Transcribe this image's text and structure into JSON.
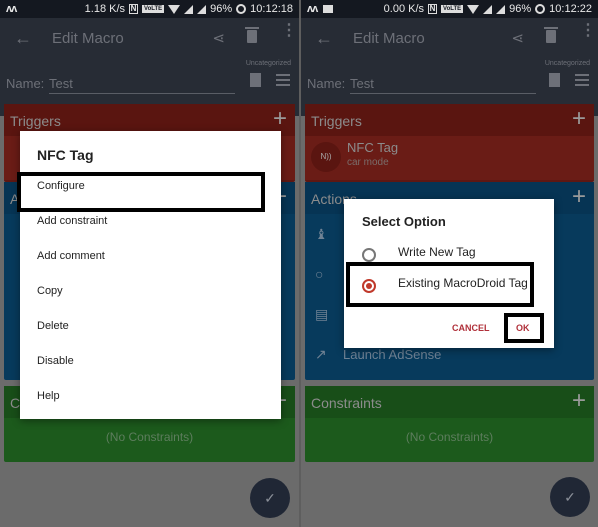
{
  "screens": [
    {
      "status": {
        "speed": "1.18 K/s",
        "battery": "96%",
        "time": "10:12:18"
      },
      "appbar": {
        "title": "Edit Macro",
        "category": "Uncategorized",
        "name_label": "Name:",
        "name_value": "Test"
      },
      "triggers": {
        "label": "Triggers"
      },
      "actions": {
        "label": "Actions"
      },
      "constraints": {
        "label": "Constraints",
        "empty": "(No Constraints)"
      },
      "menu": {
        "title": "NFC Tag",
        "items": [
          "Configure",
          "Add constraint",
          "Add comment",
          "Copy",
          "Delete",
          "Disable",
          "Help"
        ],
        "highlighted": "Configure"
      }
    },
    {
      "status": {
        "speed": "0.00 K/s",
        "battery": "96%",
        "time": "10:12:22"
      },
      "appbar": {
        "title": "Edit Macro",
        "category": "Uncategorized",
        "name_label": "Name:",
        "name_value": "Test"
      },
      "triggers": {
        "label": "Triggers",
        "items": [
          {
            "title": "NFC Tag",
            "subtitle": "car mode",
            "icon": "nfc-icon"
          }
        ]
      },
      "actions": {
        "label": "Actions",
        "items": [
          {
            "icon": "chess-icon",
            "text": ""
          },
          {
            "icon": "lightbulb-icon",
            "text": ""
          },
          {
            "icon": "message-icon",
            "text": ""
          },
          {
            "icon": "launch-icon",
            "text": "Launch AdSense"
          }
        ]
      },
      "constraints": {
        "label": "Constraints",
        "empty": "(No Constraints)"
      },
      "dialog": {
        "title": "Select Option",
        "options": [
          {
            "label": "Write New Tag",
            "selected": false
          },
          {
            "label": "Existing MacroDroid Tag",
            "selected": true
          }
        ],
        "cancel": "CANCEL",
        "ok": "OK"
      }
    }
  ],
  "icons": {
    "back": "←",
    "share": "⋖",
    "more": "⋮",
    "plus": "+",
    "check": "✓",
    "nfc": "N))",
    "chess": "♝",
    "lightbulb": "💡",
    "message": "▤",
    "launch": "↗"
  },
  "colors": {
    "accent": "#c0392b",
    "triggers": "#5e1712",
    "actions": "#073a5c",
    "constraints": "#1c5a1c",
    "appbar": "#272c35"
  }
}
